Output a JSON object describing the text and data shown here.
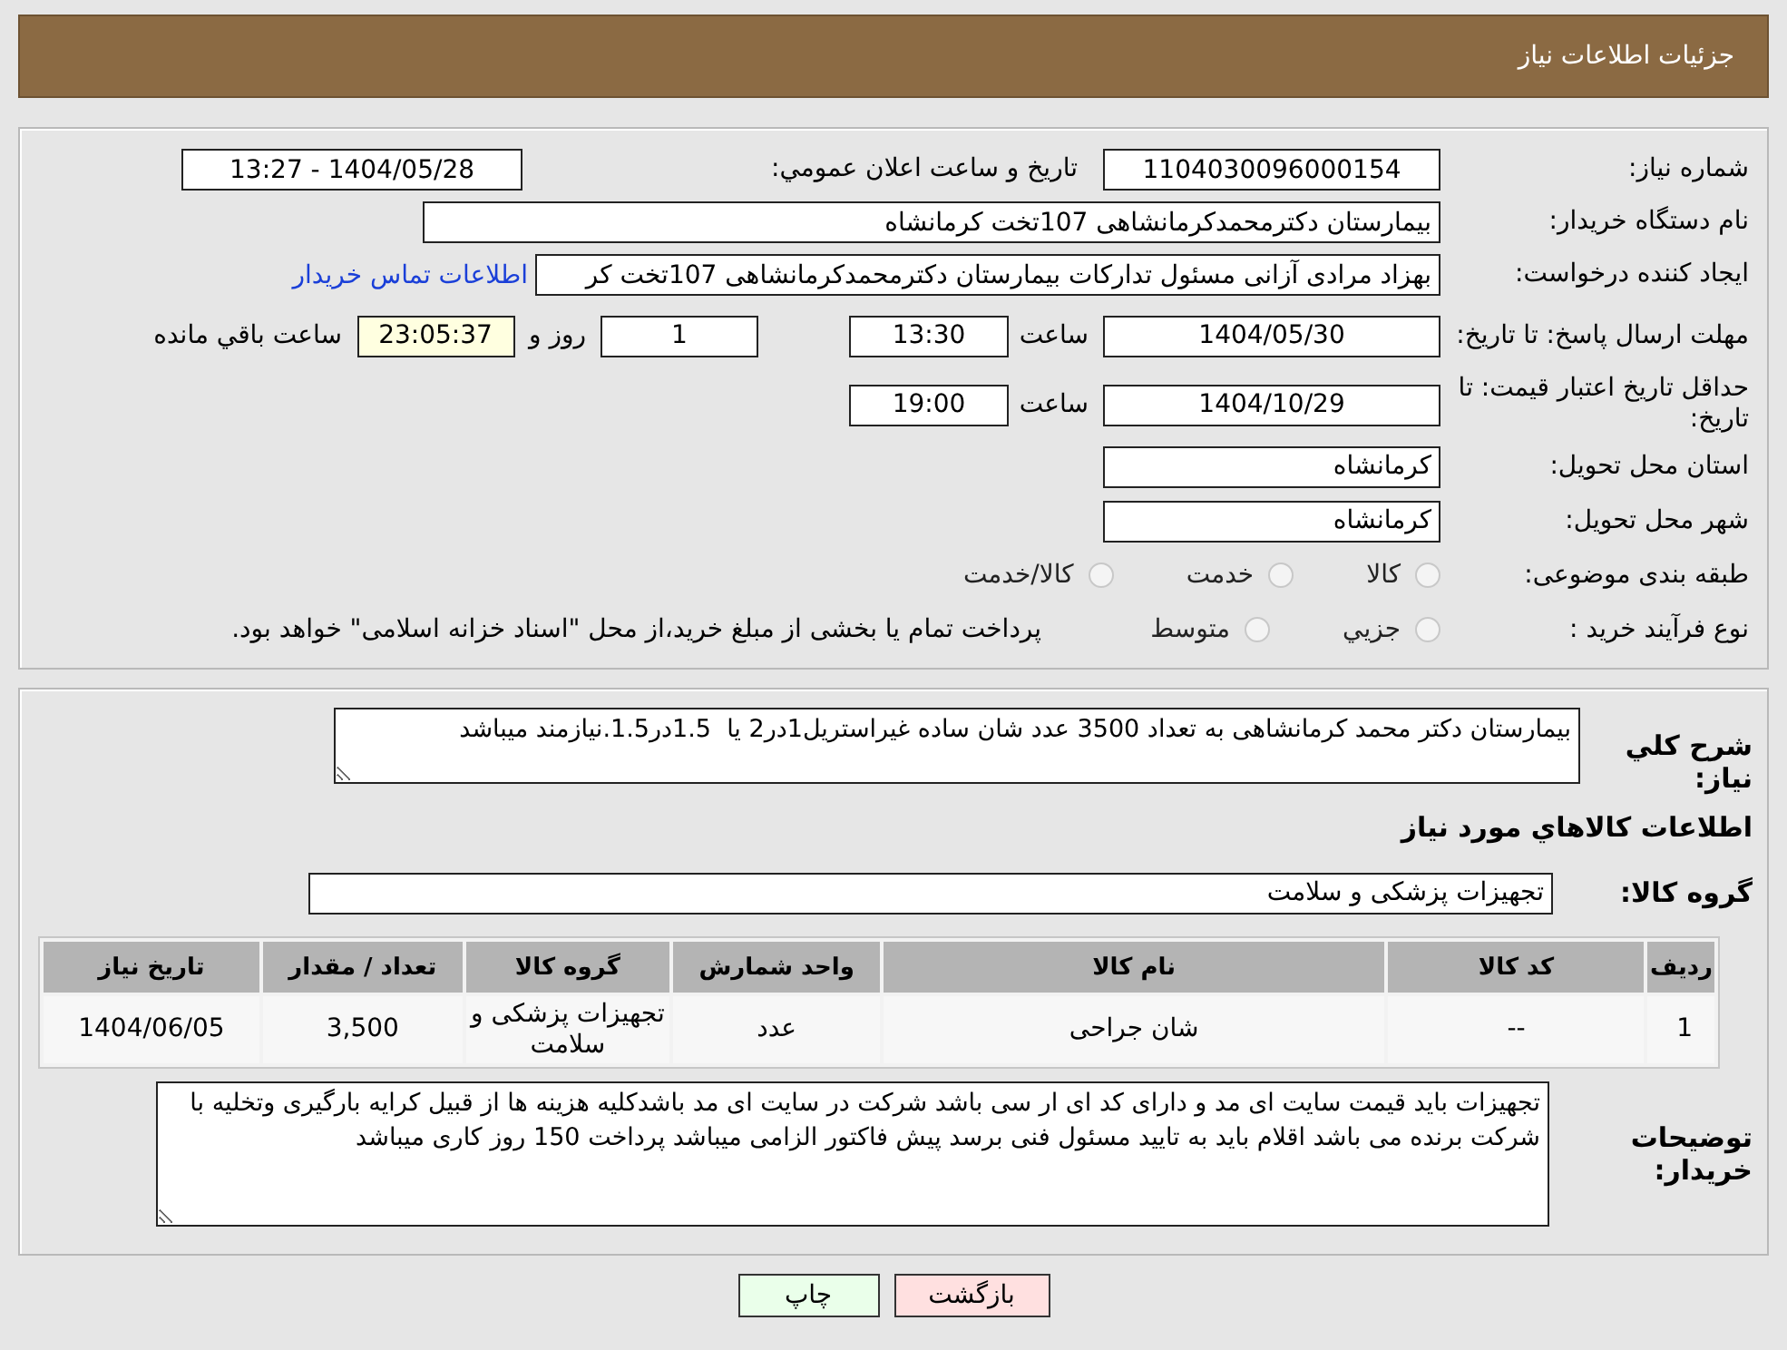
{
  "header": {
    "title": "جزئیات اطلاعات نیاز"
  },
  "need_number": {
    "label": "شماره نیاز:",
    "value": "1104030096000154"
  },
  "announce": {
    "label": "تاریخ و ساعت اعلان عمومي:",
    "value": "1404/05/28 - 13:27"
  },
  "buyer_org": {
    "label": "نام دستگاه خریدار:",
    "value": "بیمارستان دکترمحمدکرمانشاهی 107تخت کرمانشاه"
  },
  "requester": {
    "label": "ایجاد کننده درخواست:",
    "value": "بهزاد مرادی آزانی مسئول تدارکات بیمارستان دکترمحمدکرمانشاهی 107تخت کر",
    "link": "اطلاعات تماس خریدار"
  },
  "deadline": {
    "label": "مهلت ارسال پاسخ: تا تاریخ:",
    "date": "1404/05/30",
    "time_label": "ساعت",
    "time": "13:30",
    "days": "1",
    "days_label": "روز و",
    "remaining": "23:05:37",
    "remaining_label": "ساعت باقي مانده"
  },
  "validity": {
    "label": "حداقل تاریخ اعتبار قیمت: تا تاریخ:",
    "date": "1404/10/29",
    "time_label": "ساعت",
    "time": "19:00"
  },
  "province": {
    "label": "استان محل تحویل:",
    "value": "کرمانشاه"
  },
  "city": {
    "label": "شهر محل تحویل:",
    "value": "کرمانشاه"
  },
  "category": {
    "label": "طبقه بندی موضوعی:",
    "options": [
      {
        "label": "کالا",
        "selected": false
      },
      {
        "label": "خدمت",
        "selected": false
      },
      {
        "label": "کالا/خدمت",
        "selected": false
      }
    ]
  },
  "process": {
    "label": "نوع فرآیند خرید :",
    "options": [
      {
        "label": "جزیي",
        "selected": false
      },
      {
        "label": "متوسط",
        "selected": false
      }
    ],
    "note": "پرداخت تمام یا بخشی از مبلغ خرید،از محل \"اسناد خزانه اسلامی\" خواهد بود."
  },
  "description": {
    "label": "شرح كلي نياز:",
    "value": "بیمارستان دکتر محمد کرمانشاهی به تعداد 3500 عدد شان ساده غیراستریل1در2 یا  1.5در1.5.نیازمند میباشد"
  },
  "goods_title": "اطلاعات كالاهاي مورد نياز",
  "goods_group": {
    "label": "گروه کالا:",
    "value": "تجهیزات پزشکی و سلامت"
  },
  "table": {
    "columns": [
      "ردیف",
      "کد کالا",
      "نام کالا",
      "واحد شمارش",
      "گروه کالا",
      "تعداد / مقدار",
      "تاریخ نیاز"
    ],
    "rows": [
      [
        "1",
        "--",
        "شان جراحی",
        "عدد",
        "تجهیزات پزشکی و سلامت",
        "3,500",
        "1404/06/05"
      ]
    ]
  },
  "buyer_notes": {
    "label": "توضیحات خریدار:",
    "value": "تجهیزات باید قیمت سایت ای مد و دارای کد ای ار سی باشد شرکت در سایت ای مد باشدکلیه هزینه ها از قبیل کرایه بارگیری وتخلیه با شرکت برنده می باشد اقلام باید به تایید مسئول فنی برسد پیش فاکتور الزامی میباشد پرداخت 150 روز کاری میباشد"
  },
  "buttons": [
    {
      "label": "بازگشت",
      "kind": "back"
    },
    {
      "label": "چاپ",
      "kind": "print"
    }
  ]
}
